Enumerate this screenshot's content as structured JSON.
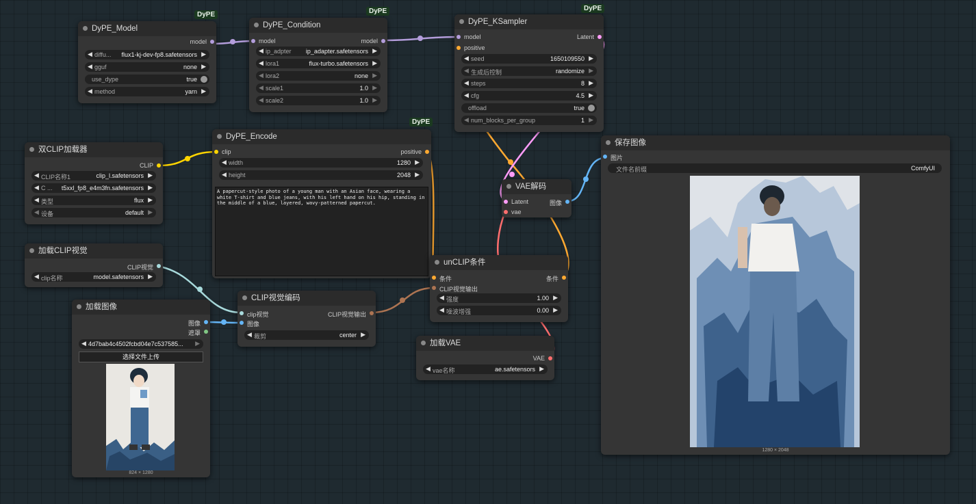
{
  "canvas_colors": {
    "model": "#b39ddb",
    "clip": "#ffd500",
    "positive": "#ffa931",
    "latent": "#ff9cf9",
    "vae": "#ff6e6e",
    "image": "#64b5f6",
    "clip_vision": "#a8dadc",
    "mask": "#81c784",
    "clip_vision_out": "#ad7452"
  },
  "badges": {
    "dype": "DyPE"
  },
  "nodes": {
    "dype_model": {
      "title": "DyPE_Model",
      "out_model": "model",
      "w_diffusion_label": "diffu...",
      "w_diffusion_value": "flux1-kj-dev-fp8.safetensors",
      "w_gguf_label": "gguf",
      "w_gguf_value": "none",
      "w_use_dype_label": "use_dype",
      "w_use_dype_value": "true",
      "w_method_label": "method",
      "w_method_value": "yarn"
    },
    "dype_condition": {
      "title": "DyPE_Condition",
      "in_model": "model",
      "out_model": "model",
      "w_ip_label": "ip_adpter",
      "w_ip_value": "ip_adapter.safetensors",
      "w_lora1_label": "lora1",
      "w_lora1_value": "flux-turbo.safetensors",
      "w_lora2_label": "lora2",
      "w_lora2_value": "none",
      "w_scale1_label": "scale1",
      "w_scale1_value": "1.0",
      "w_scale2_label": "scale2",
      "w_scale2_value": "1.0"
    },
    "dype_ksampler": {
      "title": "DyPE_KSampler",
      "in_model": "model",
      "in_positive": "positive",
      "out_latent": "Latent",
      "w_seed_label": "seed",
      "w_seed_value": "1650109550",
      "w_control_label": "生成后控制",
      "w_control_value": "randomize",
      "w_steps_label": "steps",
      "w_steps_value": "8",
      "w_cfg_label": "cfg",
      "w_cfg_value": "4.5",
      "w_offload_label": "offload",
      "w_offload_value": "true",
      "w_blocks_label": "num_blocks_per_group",
      "w_blocks_value": "1"
    },
    "dual_clip": {
      "title": "双CLIP加载器",
      "out_clip": "CLIP",
      "w_clip1_label": "CLIP名称1",
      "w_clip1_value": "clip_l.safetensors",
      "w_clip2_label": "C ...",
      "w_clip2_value": "t5xxl_fp8_e4m3fn.safetensors",
      "w_type_label": "类型",
      "w_type_value": "flux",
      "w_device_label": "设备",
      "w_device_value": "default"
    },
    "dype_encode": {
      "title": "DyPE_Encode",
      "in_clip": "clip",
      "out_positive": "positive",
      "w_width_label": "width",
      "w_width_value": "1280",
      "w_height_label": "height",
      "w_height_value": "2048",
      "prompt": "A papercut-style photo of a young man with an Asian face, wearing a white T-shirt and blue jeans, with his left hand on his hip, standing in the middle of a blue, layered, wavy-patterned papercut."
    },
    "save_image": {
      "title": "保存图像",
      "in_image": "图片",
      "w_prefix_label": "文件名前缀",
      "w_prefix_value": "ComfyUI",
      "caption": "1280 × 2048"
    },
    "vae_decode": {
      "title": "VAE解码",
      "in_latent": "Latent",
      "in_vae": "vae",
      "out_image": "图像"
    },
    "clip_vision_loader": {
      "title": "加载CLIP视觉",
      "out_clip_vision": "CLIP视觉",
      "w_name_label": "clip名称",
      "w_name_value": "model.safetensors"
    },
    "unclip": {
      "title": "unCLIP条件",
      "in_cond": "条件",
      "in_cv_out": "CLIP视觉输出",
      "out_cond": "条件",
      "w_strength_label": "强度",
      "w_strength_value": "1.00",
      "w_noise_label": "噪波增强",
      "w_noise_value": "0.00"
    },
    "load_image": {
      "title": "加载图像",
      "out_image": "图像",
      "out_mask": "遮罩",
      "w_file_value": "4d7bab4c4502fcbd04e7c537585...",
      "upload_label": "选择文件上传",
      "caption": "824 × 1280"
    },
    "clip_vision_encode": {
      "title": "CLIP视觉编码",
      "in_clip_vision": "clip视觉",
      "in_image": "图像",
      "out_cv": "CLIP视觉输出",
      "w_crop_label": "裁剪",
      "w_crop_value": "center"
    },
    "load_vae": {
      "title": "加载VAE",
      "out_vae": "VAE",
      "w_name_label": "vae名称",
      "w_name_value": "ae.safetensors"
    }
  }
}
